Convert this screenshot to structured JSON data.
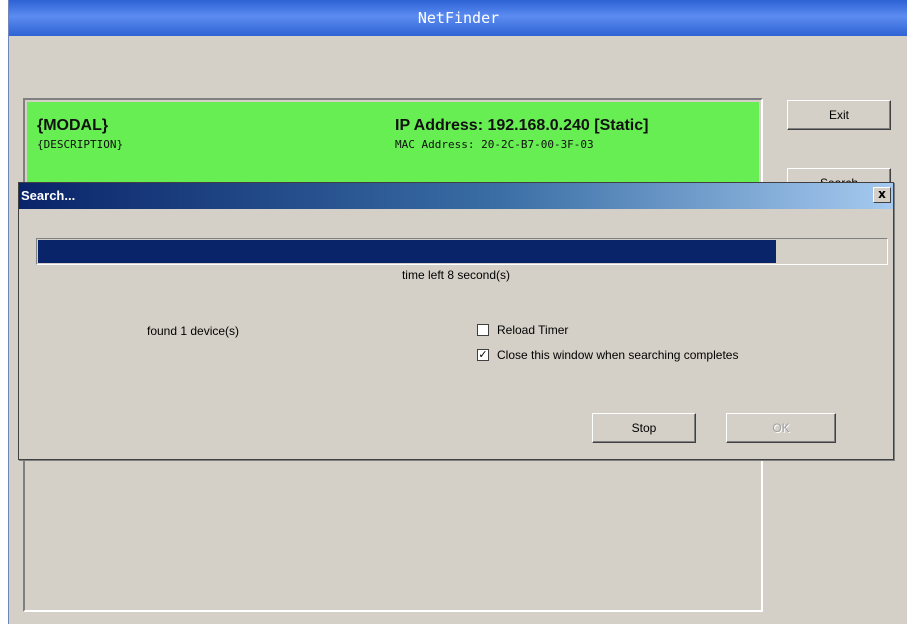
{
  "main_window": {
    "title": "NetFinder",
    "device": {
      "model": "{MODAL}",
      "description": "{DESCRIPTION}",
      "ip": "IP Address: 192.168.0.240 [Static]",
      "mac": "MAC Address: 20-2C-B7-00-3F-03"
    },
    "exit_label": "Exit",
    "search_label": "Search"
  },
  "dialog": {
    "title": "Search...",
    "close_label": "x",
    "progress": 0.87,
    "time_left": "time left 8 second(s)",
    "found": "found 1 device(s)",
    "reload_timer_label": "Reload Timer",
    "reload_timer_checked": false,
    "close_when_complete_label": "Close this window when searching completes",
    "close_when_complete_checked": true,
    "stop_label": "Stop",
    "ok_label": "OK"
  },
  "colors": {
    "device_highlight": "#66ee52",
    "progress_fill": "#0a246a",
    "titlebar_blue": "#2d62d5"
  }
}
